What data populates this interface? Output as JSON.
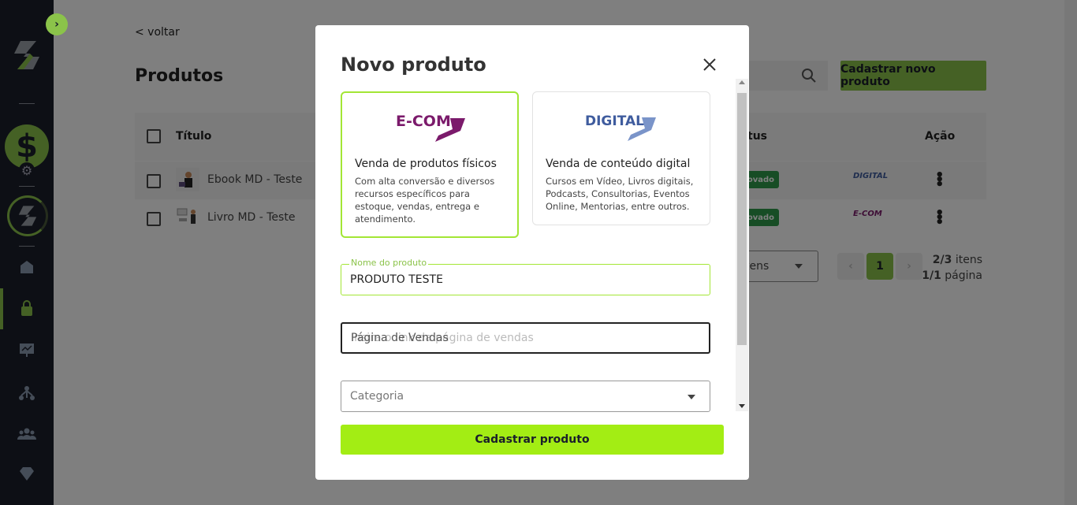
{
  "sidebar": {
    "toggle_glyph": "›",
    "dollar_glyph": "$",
    "gear_glyph": "⚙",
    "icons": [
      "home-icon",
      "bag-icon",
      "presentation-icon",
      "network-icon",
      "users-icon",
      "diamond-icon"
    ],
    "accent_color": "#8bc34a"
  },
  "main": {
    "back_label": "< voltar",
    "page_title": "Produtos",
    "new_product_label": "Cadastrar novo produto",
    "table": {
      "col_title": "Título",
      "col_status": "tus",
      "col_action": "Ação",
      "rows": [
        {
          "name": "Ebook MD - Teste",
          "status": "ovado",
          "type_logo": "DIGITAL"
        },
        {
          "name": "Livro MD - Teste",
          "status": "ovado",
          "type_logo": "E-COM"
        }
      ]
    },
    "pagination": {
      "per_page_label": "tens",
      "current_page": "1",
      "items_count": "2/3",
      "items_suffix": " itens",
      "page_count": "1/1",
      "page_suffix": " página"
    }
  },
  "modal": {
    "title": "Novo produto",
    "cards": [
      {
        "logo": "E-COM",
        "logo_color": "#7b1a6b",
        "heading": "Venda de produtos físicos",
        "description": "Com alta conversão e diversos recursos específicos para estoque, vendas, entrega e atendimento.",
        "selected": true
      },
      {
        "logo": "DIGITAL",
        "logo_color": "#3f5c9e",
        "heading": "Venda de conteúdo digital",
        "description": "Cursos em Vídeo, Livros digitais, Podcasts, Consultorias, Eventos Online, Mentorias, entre outros.",
        "selected": false
      }
    ],
    "fields": {
      "name_label": "Nome do produto",
      "name_value": "PRODUTO TESTE",
      "sales_page_label": "Página de Vendas",
      "sales_page_placeholder": "Insira o link da página de vendas",
      "category_label": "Categoria"
    },
    "submit_label": "Cadastrar produto",
    "submit_color": "#a3ed14"
  }
}
